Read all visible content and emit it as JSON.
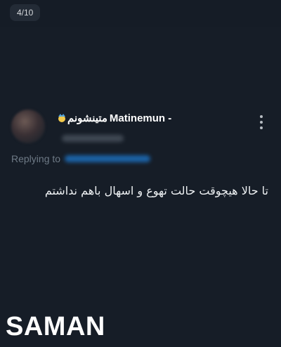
{
  "viewer": {
    "page_counter": "4/10"
  },
  "tweet": {
    "display_name": "Matinemun -",
    "display_name_persian": "متینشونم",
    "replying_label": "Replying to",
    "text": "تا حالا هیچوقت حالت تهوع و اسهال باهم نداشتم",
    "icons": [
      "avatar",
      "emoji-icon",
      "more-vertical-icon"
    ]
  },
  "watermark": {
    "text": "SAMAN"
  },
  "colors": {
    "background": "#161d27",
    "mention": "#1d9bf0",
    "secondary_text": "#6e7a86"
  }
}
